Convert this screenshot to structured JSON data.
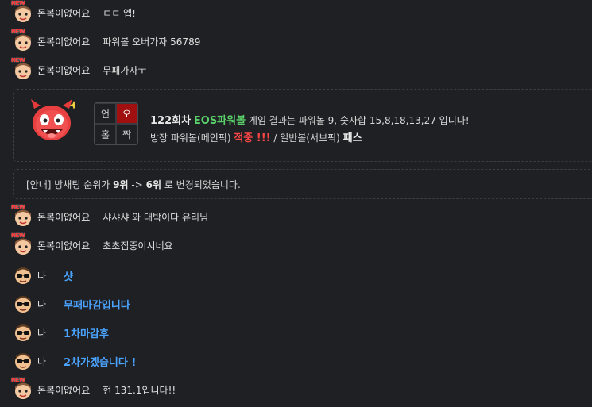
{
  "messages_top": [
    {
      "nick": "돈복이없어요",
      "text": "ㅌㅌ 엡!"
    },
    {
      "nick": "돈복이없어요",
      "text": "파워볼 오버가자 56789"
    },
    {
      "nick": "돈복이없어요",
      "text": "무패가자ㅜ"
    }
  ],
  "badge": "NEW",
  "result": {
    "grid": [
      "언",
      "오",
      "홀",
      "짝"
    ],
    "round": "122회차",
    "game": "EOS파워볼",
    "summary": "게임 결과는 파워볼 9, 숫자합 15,8,18,13,27 입니다!",
    "pick_prefix": "방장 파워볼(메인픽)",
    "hit": "적중 !!!",
    "pick_mid": "/ 일반볼(서브픽)",
    "pass": "패스"
  },
  "notice": {
    "prefix": "[안내] 방채팅 순위가",
    "from": "9위",
    "arrow": "->",
    "to": "6위",
    "suffix": "로 변경되었습니다."
  },
  "messages_mid": [
    {
      "nick": "돈복이없어요",
      "text": "샤샤샤 와 대박이다 유리님"
    },
    {
      "nick": "돈복이없어요",
      "text": "초초집중이시네요"
    }
  ],
  "my_messages": [
    {
      "nick": "나",
      "text": "샷"
    },
    {
      "nick": "나",
      "text": "무패마감입니다"
    },
    {
      "nick": "나",
      "text": "1차마감후"
    },
    {
      "nick": "나",
      "text": "2차가겠습니다 !"
    }
  ],
  "last_message": {
    "nick": "돈복이없어요",
    "text": "현 131.1입니다!!"
  },
  "colors": {
    "background": "#1f2023",
    "win_green": "#5ad06a",
    "hit_red": "#ff4646",
    "me_blue": "#4aa3ff",
    "active_cell": "#a11010"
  }
}
